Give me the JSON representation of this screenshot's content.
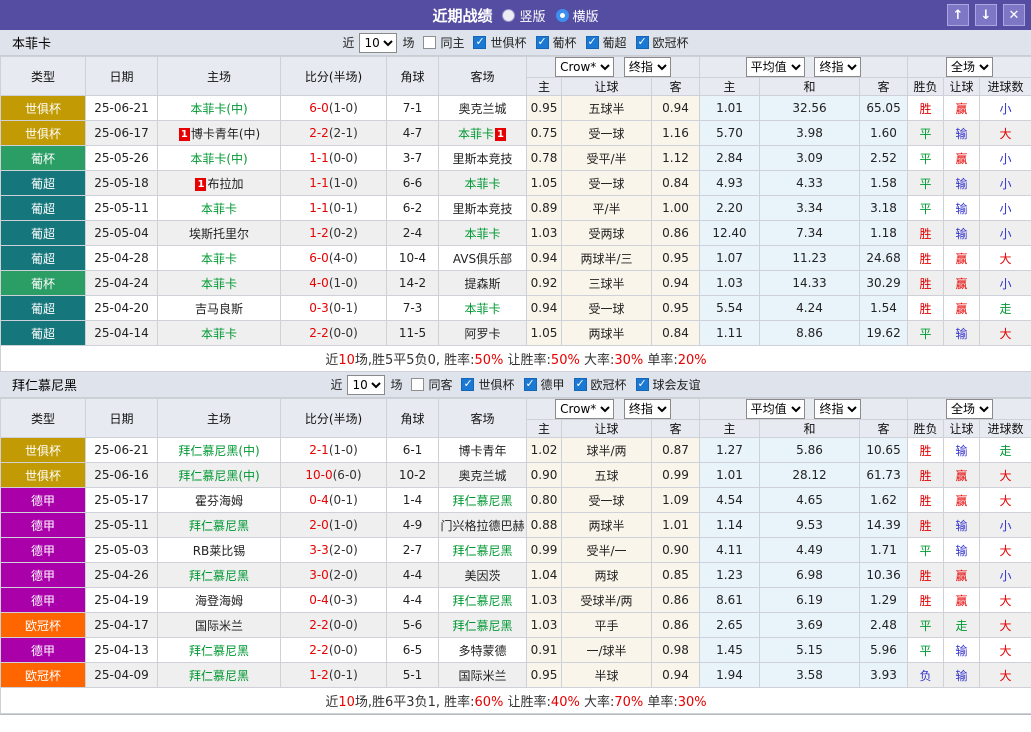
{
  "titlebar": {
    "title": "近期战绩",
    "radios": [
      "竖版",
      "横版"
    ],
    "selected": "横版",
    "up_icon": "↑",
    "down_icon": "↓",
    "close_icon": "✕"
  },
  "type_colors": {
    "世俱杯": "#c29a03",
    "葡杯": "#2b9e66",
    "葡超": "#15767b",
    "德甲": "#aa00aa",
    "欧冠杯": "#ff6600"
  },
  "sections": [
    {
      "team": "本菲卡",
      "filter": {
        "near": "近",
        "count": "10",
        "games": "场",
        "same": "同主",
        "same_checked": false,
        "leagues": [
          "世俱杯",
          "葡杯",
          "葡超",
          "欧冠杯"
        ],
        "leagues_checked": [
          true,
          true,
          true,
          true
        ]
      },
      "header": {
        "basic": [
          "类型",
          "日期",
          "主场",
          "比分(半场)",
          "角球",
          "客场"
        ],
        "odds_selects": [
          "Crow*",
          "终指"
        ],
        "odds_cols": [
          "主",
          "让球",
          "客"
        ],
        "euro_selects": [
          "平均值",
          "终指"
        ],
        "euro_cols": [
          "主",
          "和",
          "客"
        ],
        "result_select": "全场",
        "result_cols": [
          "胜负",
          "让球",
          "进球数"
        ]
      },
      "rows": [
        {
          "type": "世俱杯",
          "date": "25-06-21",
          "home": "本菲卡(中)",
          "home_hl": true,
          "score": "6-0",
          "half": "(1-0)",
          "corner": "7-1",
          "away": "奥克兰城",
          "away_hl": false,
          "h": [
            "0.95",
            "五球半",
            "0.94"
          ],
          "e": [
            "1.01",
            "32.56",
            "65.05"
          ],
          "res": [
            "胜",
            "赢",
            "小"
          ]
        },
        {
          "type": "世俱杯",
          "date": "25-06-17",
          "home": "博卡青年(中)",
          "home_hl": false,
          "home_card": "1",
          "home_card_pos": "before",
          "score": "2-2",
          "half": "(2-1)",
          "corner": "4-7",
          "away": "本菲卡",
          "away_hl": true,
          "away_card": "1",
          "away_card_pos": "after",
          "h": [
            "0.75",
            "受一球",
            "1.16"
          ],
          "e": [
            "5.70",
            "3.98",
            "1.60"
          ],
          "res": [
            "平",
            "输",
            "大"
          ]
        },
        {
          "type": "葡杯",
          "date": "25-05-26",
          "home": "本菲卡(中)",
          "home_hl": true,
          "score": "1-1",
          "half": "(0-0)",
          "corner": "3-7",
          "away": "里斯本竞技",
          "away_hl": false,
          "h": [
            "0.78",
            "受平/半",
            "1.12"
          ],
          "e": [
            "2.84",
            "3.09",
            "2.52"
          ],
          "res": [
            "平",
            "赢",
            "小"
          ]
        },
        {
          "type": "葡超",
          "date": "25-05-18",
          "home": "布拉加",
          "home_hl": false,
          "home_card": "1",
          "home_card_pos": "before",
          "score": "1-1",
          "half": "(1-0)",
          "corner": "6-6",
          "away": "本菲卡",
          "away_hl": true,
          "h": [
            "1.05",
            "受一球",
            "0.84"
          ],
          "e": [
            "4.93",
            "4.33",
            "1.58"
          ],
          "res": [
            "平",
            "输",
            "小"
          ]
        },
        {
          "type": "葡超",
          "date": "25-05-11",
          "home": "本菲卡",
          "home_hl": true,
          "score": "1-1",
          "half": "(0-1)",
          "corner": "6-2",
          "away": "里斯本竞技",
          "away_hl": false,
          "h": [
            "0.89",
            "平/半",
            "1.00"
          ],
          "e": [
            "2.20",
            "3.34",
            "3.18"
          ],
          "res": [
            "平",
            "输",
            "小"
          ]
        },
        {
          "type": "葡超",
          "date": "25-05-04",
          "home": "埃斯托里尔",
          "home_hl": false,
          "score": "1-2",
          "half": "(0-2)",
          "corner": "2-4",
          "away": "本菲卡",
          "away_hl": true,
          "h": [
            "1.03",
            "受两球",
            "0.86"
          ],
          "e": [
            "12.40",
            "7.34",
            "1.18"
          ],
          "res": [
            "胜",
            "输",
            "小"
          ]
        },
        {
          "type": "葡超",
          "date": "25-04-28",
          "home": "本菲卡",
          "home_hl": true,
          "score": "6-0",
          "half": "(4-0)",
          "corner": "10-4",
          "away": "AVS俱乐部",
          "away_hl": false,
          "h": [
            "0.94",
            "两球半/三",
            "0.95"
          ],
          "e": [
            "1.07",
            "11.23",
            "24.68"
          ],
          "res": [
            "胜",
            "赢",
            "大"
          ]
        },
        {
          "type": "葡杯",
          "date": "25-04-24",
          "home": "本菲卡",
          "home_hl": true,
          "score": "4-0",
          "half": "(1-0)",
          "corner": "14-2",
          "away": "提森斯",
          "away_hl": false,
          "h": [
            "0.92",
            "三球半",
            "0.94"
          ],
          "e": [
            "1.03",
            "14.33",
            "30.29"
          ],
          "res": [
            "胜",
            "赢",
            "小"
          ]
        },
        {
          "type": "葡超",
          "date": "25-04-20",
          "home": "吉马良斯",
          "home_hl": false,
          "score": "0-3",
          "half": "(0-1)",
          "corner": "7-3",
          "away": "本菲卡",
          "away_hl": true,
          "h": [
            "0.94",
            "受一球",
            "0.95"
          ],
          "e": [
            "5.54",
            "4.24",
            "1.54"
          ],
          "res": [
            "胜",
            "赢",
            "走"
          ]
        },
        {
          "type": "葡超",
          "date": "25-04-14",
          "home": "本菲卡",
          "home_hl": true,
          "score": "2-2",
          "half": "(0-0)",
          "corner": "11-5",
          "away": "阿罗卡",
          "away_hl": false,
          "h": [
            "1.05",
            "两球半",
            "0.84"
          ],
          "e": [
            "1.11",
            "8.86",
            "19.62"
          ],
          "res": [
            "平",
            "输",
            "大"
          ]
        }
      ],
      "summary": [
        [
          "近",
          "b"
        ],
        [
          "10",
          "r"
        ],
        [
          "场,胜5平5负0, 胜率:",
          "b"
        ],
        [
          "50%",
          "r"
        ],
        [
          " 让胜率:",
          "b"
        ],
        [
          "50%",
          "r"
        ],
        [
          " 大率:",
          "b"
        ],
        [
          "30%",
          "r"
        ],
        [
          " 单率:",
          "b"
        ],
        [
          "20%",
          "r"
        ]
      ]
    },
    {
      "team": "拜仁慕尼黑",
      "filter": {
        "near": "近",
        "count": "10",
        "games": "场",
        "same": "同客",
        "same_checked": false,
        "leagues": [
          "世俱杯",
          "德甲",
          "欧冠杯",
          "球会友谊"
        ],
        "leagues_checked": [
          true,
          true,
          true,
          true
        ]
      },
      "header": {
        "basic": [
          "类型",
          "日期",
          "主场",
          "比分(半场)",
          "角球",
          "客场"
        ],
        "odds_selects": [
          "Crow*",
          "终指"
        ],
        "odds_cols": [
          "主",
          "让球",
          "客"
        ],
        "euro_selects": [
          "平均值",
          "终指"
        ],
        "euro_cols": [
          "主",
          "和",
          "客"
        ],
        "result_select": "全场",
        "result_cols": [
          "胜负",
          "让球",
          "进球数"
        ]
      },
      "rows": [
        {
          "type": "世俱杯",
          "date": "25-06-21",
          "home": "拜仁慕尼黑(中)",
          "home_hl": true,
          "score": "2-1",
          "half": "(1-0)",
          "corner": "6-1",
          "away": "博卡青年",
          "away_hl": false,
          "h": [
            "1.02",
            "球半/两",
            "0.87"
          ],
          "e": [
            "1.27",
            "5.86",
            "10.65"
          ],
          "res": [
            "胜",
            "输",
            "走"
          ]
        },
        {
          "type": "世俱杯",
          "date": "25-06-16",
          "home": "拜仁慕尼黑(中)",
          "home_hl": true,
          "score": "10-0",
          "half": "(6-0)",
          "corner": "10-2",
          "away": "奥克兰城",
          "away_hl": false,
          "h": [
            "0.90",
            "五球",
            "0.99"
          ],
          "e": [
            "1.01",
            "28.12",
            "61.73"
          ],
          "res": [
            "胜",
            "赢",
            "大"
          ]
        },
        {
          "type": "德甲",
          "date": "25-05-17",
          "home": "霍芬海姆",
          "home_hl": false,
          "score": "0-4",
          "half": "(0-1)",
          "corner": "1-4",
          "away": "拜仁慕尼黑",
          "away_hl": true,
          "h": [
            "0.80",
            "受一球",
            "1.09"
          ],
          "e": [
            "4.54",
            "4.65",
            "1.62"
          ],
          "res": [
            "胜",
            "赢",
            "大"
          ]
        },
        {
          "type": "德甲",
          "date": "25-05-11",
          "home": "拜仁慕尼黑",
          "home_hl": true,
          "score": "2-0",
          "half": "(1-0)",
          "corner": "4-9",
          "away": "门兴格拉德巴赫",
          "away_hl": false,
          "h": [
            "0.88",
            "两球半",
            "1.01"
          ],
          "e": [
            "1.14",
            "9.53",
            "14.39"
          ],
          "res": [
            "胜",
            "输",
            "小"
          ]
        },
        {
          "type": "德甲",
          "date": "25-05-03",
          "home": "RB莱比锡",
          "home_hl": false,
          "score": "3-3",
          "half": "(2-0)",
          "corner": "2-7",
          "away": "拜仁慕尼黑",
          "away_hl": true,
          "h": [
            "0.99",
            "受半/一",
            "0.90"
          ],
          "e": [
            "4.11",
            "4.49",
            "1.71"
          ],
          "res": [
            "平",
            "输",
            "大"
          ]
        },
        {
          "type": "德甲",
          "date": "25-04-26",
          "home": "拜仁慕尼黑",
          "home_hl": true,
          "score": "3-0",
          "half": "(2-0)",
          "corner": "4-4",
          "away": "美因茨",
          "away_hl": false,
          "h": [
            "1.04",
            "两球",
            "0.85"
          ],
          "e": [
            "1.23",
            "6.98",
            "10.36"
          ],
          "res": [
            "胜",
            "赢",
            "小"
          ]
        },
        {
          "type": "德甲",
          "date": "25-04-19",
          "home": "海登海姆",
          "home_hl": false,
          "score": "0-4",
          "half": "(0-3)",
          "corner": "4-4",
          "away": "拜仁慕尼黑",
          "away_hl": true,
          "h": [
            "1.03",
            "受球半/两",
            "0.86"
          ],
          "e": [
            "8.61",
            "6.19",
            "1.29"
          ],
          "res": [
            "胜",
            "赢",
            "大"
          ]
        },
        {
          "type": "欧冠杯",
          "date": "25-04-17",
          "home": "国际米兰",
          "home_hl": false,
          "score": "2-2",
          "half": "(0-0)",
          "corner": "5-6",
          "away": "拜仁慕尼黑",
          "away_hl": true,
          "h": [
            "1.03",
            "平手",
            "0.86"
          ],
          "e": [
            "2.65",
            "3.69",
            "2.48"
          ],
          "res": [
            "平",
            "走",
            "大"
          ]
        },
        {
          "type": "德甲",
          "date": "25-04-13",
          "home": "拜仁慕尼黑",
          "home_hl": true,
          "score": "2-2",
          "half": "(0-0)",
          "corner": "6-5",
          "away": "多特蒙德",
          "away_hl": false,
          "h": [
            "0.91",
            "一/球半",
            "0.98"
          ],
          "e": [
            "1.45",
            "5.15",
            "5.96"
          ],
          "res": [
            "平",
            "输",
            "大"
          ]
        },
        {
          "type": "欧冠杯",
          "date": "25-04-09",
          "home": "拜仁慕尼黑",
          "home_hl": true,
          "score": "1-2",
          "half": "(0-1)",
          "corner": "5-1",
          "away": "国际米兰",
          "away_hl": false,
          "h": [
            "0.95",
            "半球",
            "0.94"
          ],
          "e": [
            "1.94",
            "3.58",
            "3.93"
          ],
          "res": [
            "负",
            "输",
            "大"
          ]
        }
      ],
      "summary": [
        [
          "近",
          "b"
        ],
        [
          "10",
          "r"
        ],
        [
          "场,胜6平3负1, 胜率:",
          "b"
        ],
        [
          "60%",
          "r"
        ],
        [
          " 让胜率:",
          "b"
        ],
        [
          "40%",
          "r"
        ],
        [
          " 大率:",
          "b"
        ],
        [
          "70%",
          "r"
        ],
        [
          " 单率:",
          "b"
        ],
        [
          "30%",
          "r"
        ]
      ]
    }
  ]
}
